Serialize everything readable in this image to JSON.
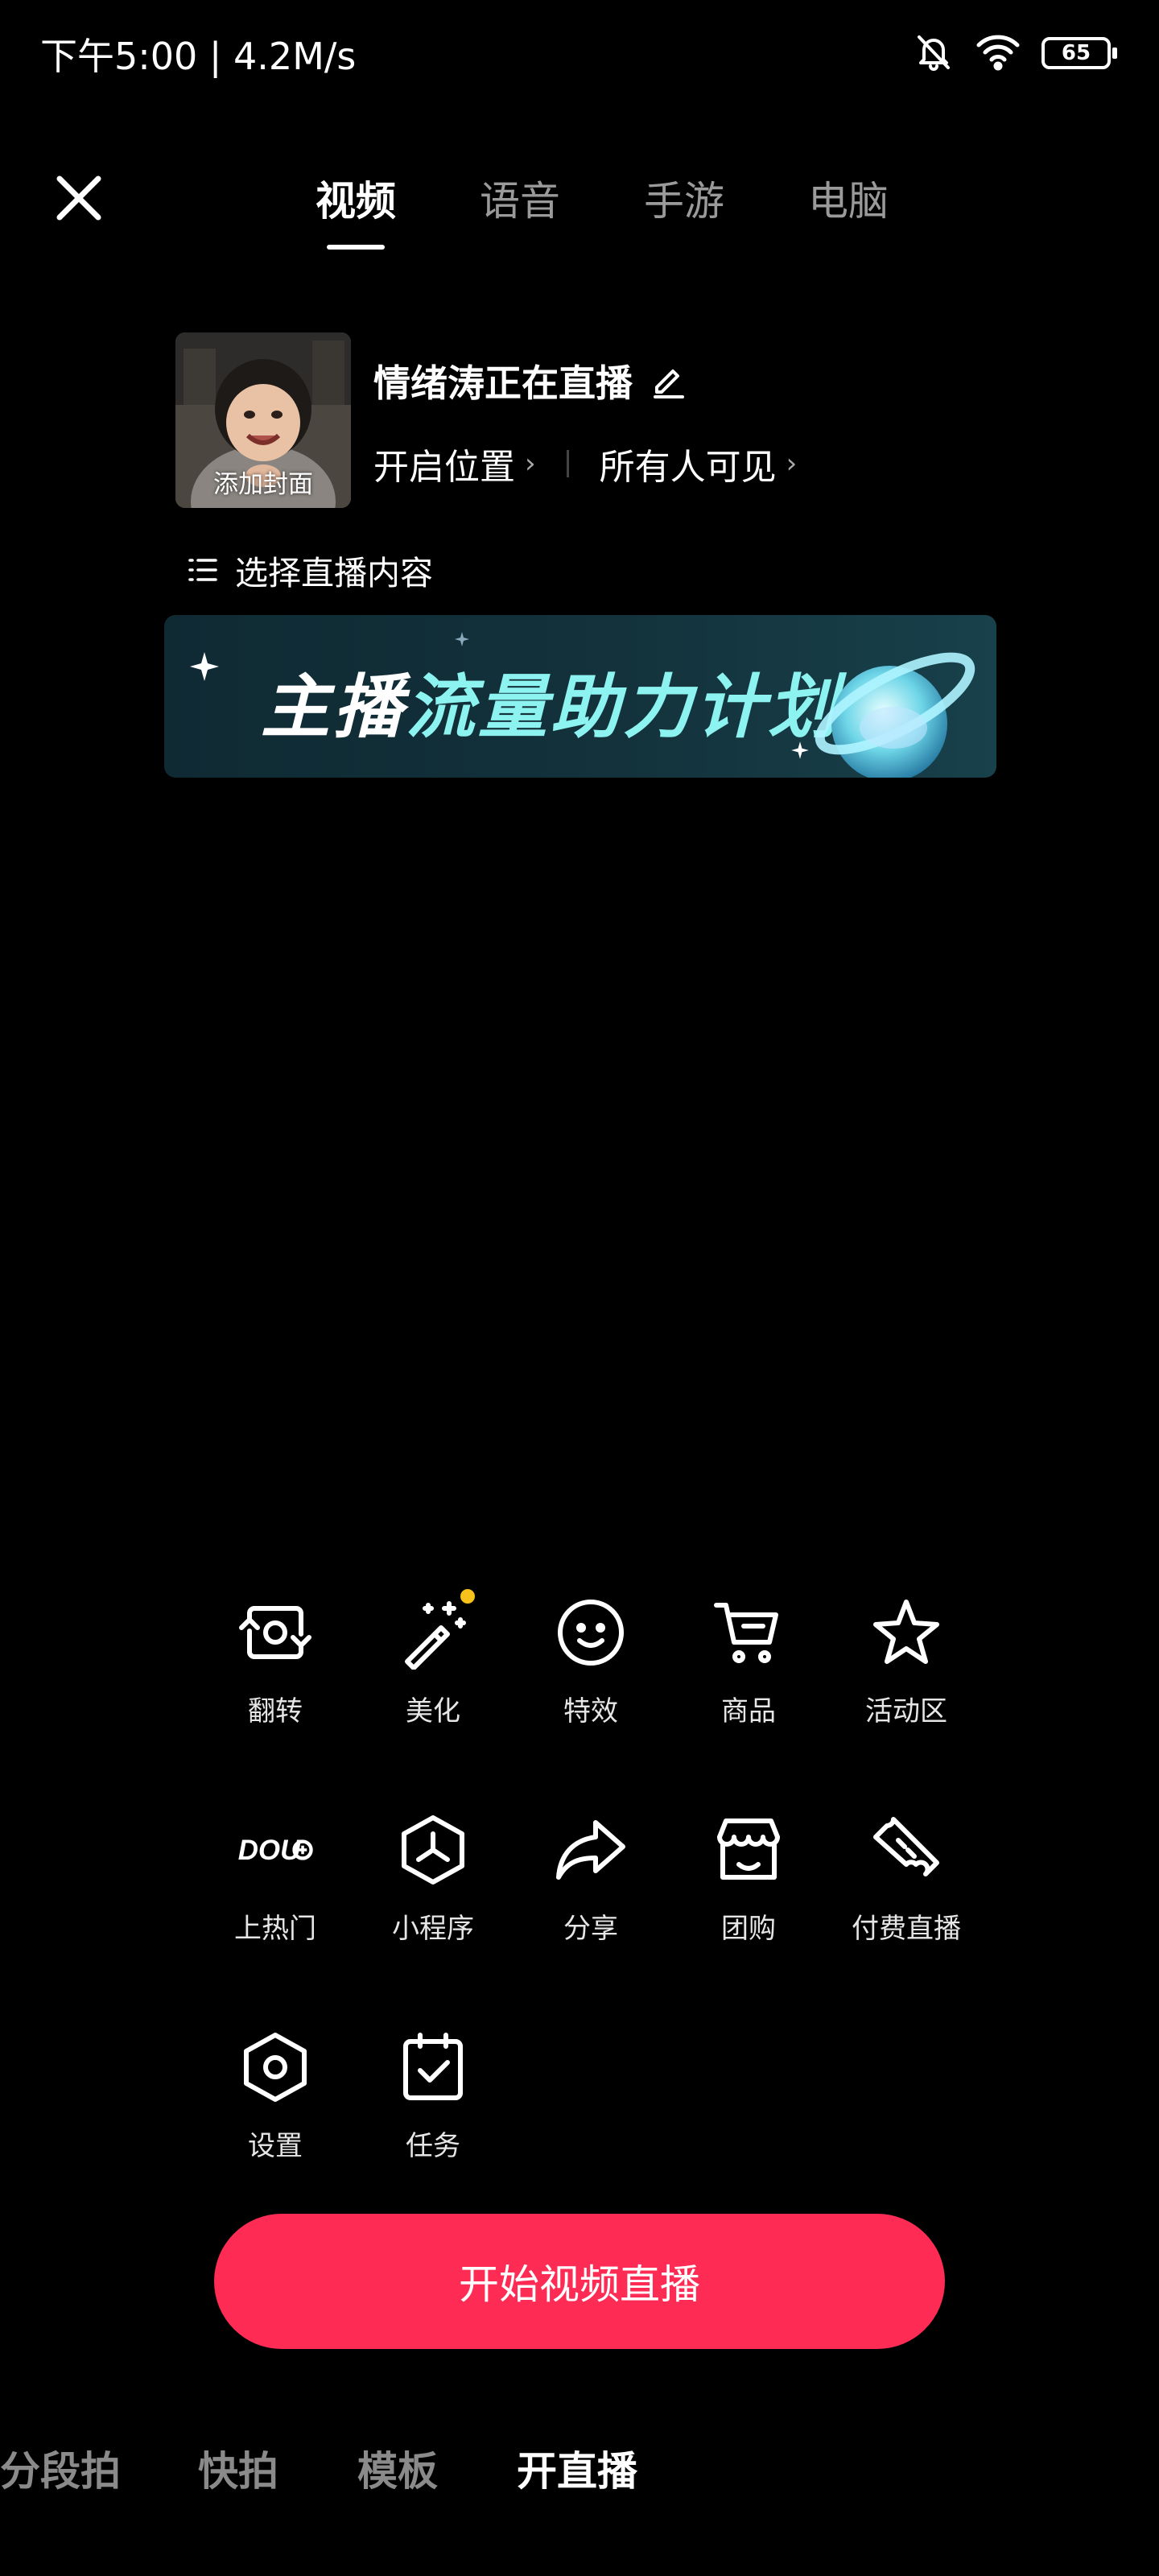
{
  "status_bar": {
    "time_speed": "下午5:00 | 4.2M/s",
    "battery": "65"
  },
  "tabs": [
    {
      "label": "视频",
      "active": true
    },
    {
      "label": "语音",
      "active": false
    },
    {
      "label": "手游",
      "active": false
    },
    {
      "label": "电脑",
      "active": false
    }
  ],
  "room": {
    "cover_label": "添加封面",
    "title": "情绪涛正在直播",
    "location": "开启位置",
    "visibility": "所有人可见",
    "select_content": "选择直播内容"
  },
  "banner": {
    "text_white": "主播",
    "text_cyan": "流量助力计划"
  },
  "tools": [
    {
      "label": "翻转",
      "icon": "flip-camera-icon"
    },
    {
      "label": "美化",
      "icon": "magic-wand-icon"
    },
    {
      "label": "特效",
      "icon": "smile-face-icon"
    },
    {
      "label": "商品",
      "icon": "cart-icon"
    },
    {
      "label": "活动区",
      "icon": "star-icon"
    },
    {
      "label": "上热门",
      "icon": "dou-plus-icon"
    },
    {
      "label": "小程序",
      "icon": "mini-program-icon"
    },
    {
      "label": "分享",
      "icon": "share-arrow-icon"
    },
    {
      "label": "团购",
      "icon": "store-icon"
    },
    {
      "label": "付费直播",
      "icon": "ticket-icon"
    },
    {
      "label": "设置",
      "icon": "settings-hex-icon"
    },
    {
      "label": "任务",
      "icon": "task-clipboard-icon"
    }
  ],
  "dou_text": "DOU",
  "start_button": "开始视频直播",
  "modes": [
    {
      "label": "分段拍",
      "active": false
    },
    {
      "label": "快拍",
      "active": false
    },
    {
      "label": "模板",
      "active": false
    },
    {
      "label": "开直播",
      "active": true
    }
  ],
  "colors": {
    "accent": "#fe2c55",
    "banner_cyan": "#8cf3f0",
    "notify_dot": "#f6c21b"
  }
}
